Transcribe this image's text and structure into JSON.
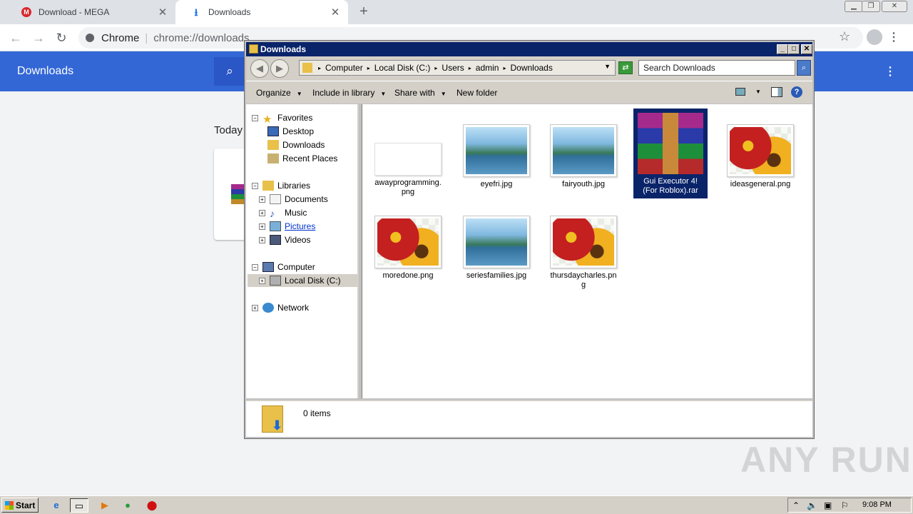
{
  "chrome": {
    "tabs": [
      {
        "title": "Download - MEGA",
        "active": false
      },
      {
        "title": "Downloads",
        "active": true
      }
    ],
    "new_tab": "+",
    "omnibox_label": "Chrome",
    "omnibox_url": "chrome://downloads",
    "downloads_page": {
      "title": "Downloads",
      "section_today": "Today"
    }
  },
  "explorer": {
    "title": "Downloads",
    "breadcrumb": [
      "Computer",
      "Local Disk (C:)",
      "Users",
      "admin",
      "Downloads"
    ],
    "search_placeholder": "Search Downloads",
    "commands": [
      "Organize",
      "Include in library",
      "Share with",
      "New folder"
    ],
    "nav": {
      "favorites": {
        "label": "Favorites",
        "items": [
          "Desktop",
          "Downloads",
          "Recent Places"
        ]
      },
      "libraries": {
        "label": "Libraries",
        "items": [
          "Documents",
          "Music",
          "Pictures",
          "Videos"
        ]
      },
      "computer": {
        "label": "Computer",
        "items": [
          "Local Disk (C:)"
        ]
      },
      "network": {
        "label": "Network"
      }
    },
    "files": [
      {
        "name": "awayprogramming.png",
        "line1": "awayprogramming.",
        "line2": "png",
        "thumb": "blank"
      },
      {
        "name": "eyefri.jpg",
        "line1": "eyefri.jpg",
        "line2": "",
        "thumb": "ocean"
      },
      {
        "name": "fairyouth.jpg",
        "line1": "fairyouth.jpg",
        "line2": "",
        "thumb": "ocean"
      },
      {
        "name": "Gui Executor 4! (For Roblox).rar",
        "line1": "Gui Executor 4!",
        "line2": "(For Roblox).rar",
        "thumb": "rar",
        "selected": true
      },
      {
        "name": "ideasgeneral.png",
        "line1": "ideasgeneral.png",
        "line2": "",
        "thumb": "flower"
      },
      {
        "name": "moredone.png",
        "line1": "moredone.png",
        "line2": "",
        "thumb": "flower"
      },
      {
        "name": "seriesfamilies.jpg",
        "line1": "seriesfamilies.jpg",
        "line2": "",
        "thumb": "ocean"
      },
      {
        "name": "thursdaycharles.png",
        "line1": "thursdaycharles.pn",
        "line2": "g",
        "thumb": "flower"
      }
    ],
    "details": {
      "count": "0 items"
    }
  },
  "taskbar": {
    "start": "Start",
    "clock": "9:08 PM"
  },
  "watermark": "ANY RUN",
  "colors": {
    "chrome_header": "#3367d6",
    "title_bar": "#0a246a",
    "selection": "#0a246a"
  }
}
